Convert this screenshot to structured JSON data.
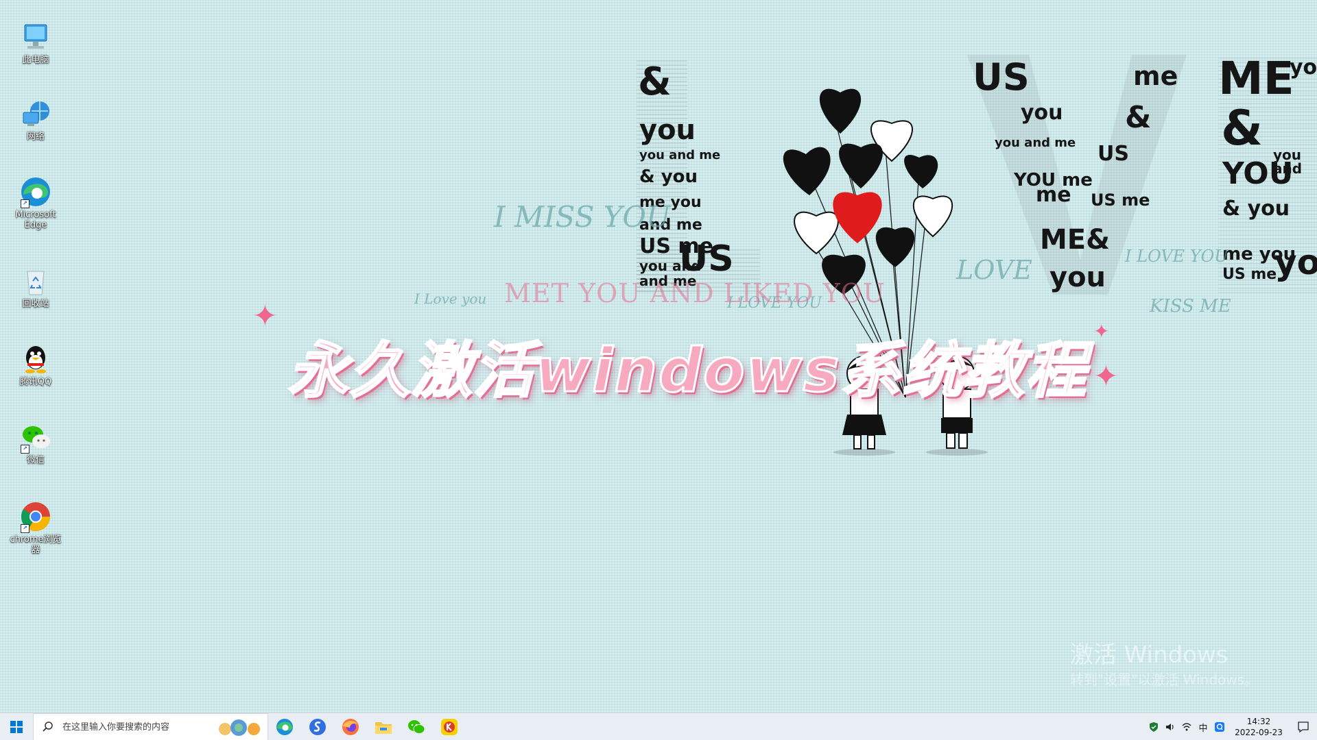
{
  "desktop": {
    "icons": [
      {
        "label": "此电脑",
        "icon": "this-pc-icon"
      },
      {
        "label": "网络",
        "icon": "network-icon"
      },
      {
        "label": "Microsoft Edge",
        "icon": "edge-icon"
      },
      {
        "label": "回收站",
        "icon": "recycle-bin-icon"
      },
      {
        "label": "腾讯QQ",
        "icon": "qq-icon"
      },
      {
        "label": "微信",
        "icon": "wechat-icon"
      },
      {
        "label": "chrome浏览器",
        "icon": "chrome-icon"
      }
    ]
  },
  "wallpaper": {
    "main_word": "LOVE",
    "faint_texts": [
      "I MISS YOU",
      "LOVE",
      "I LOVE YOU",
      "KISS ME",
      "I LOVE YOU",
      "I Love you"
    ],
    "subtitle": "MET YOU AND LIKED YOU",
    "banner": "永久激活windows系统教程",
    "watermark_line1": "激活 Windows",
    "watermark_line2": "转到\"设置\"以激活 Windows。"
  },
  "taskbar": {
    "search_placeholder": "在这里输入你要搜索的内容",
    "pinned": [
      "edge-icon",
      "sogou-icon",
      "firefox-icon",
      "file-explorer-icon",
      "wechat-icon",
      "kugou-icon"
    ],
    "tray_icons": [
      "security-icon",
      "volume-icon",
      "wifi-icon",
      "ime-icon",
      "qq-tray-icon"
    ],
    "ime_label": "中",
    "time": "14:32",
    "date": "2022-09-23"
  },
  "colors": {
    "background": "#cde8ea",
    "banner_pink": "#f7a9c0",
    "heart_red": "#e01b1b",
    "taskbar": "#e9eef4"
  }
}
